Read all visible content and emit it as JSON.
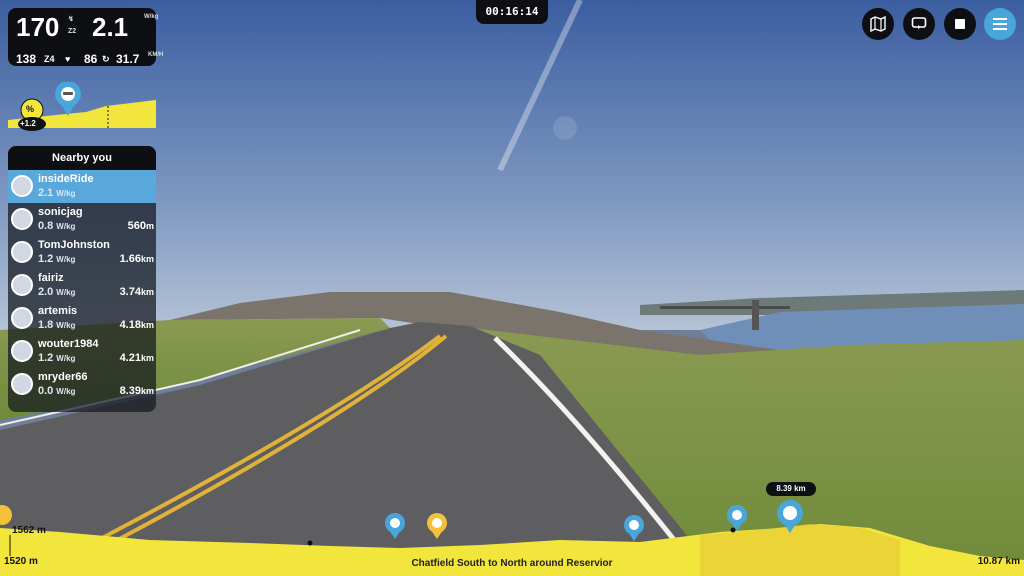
{
  "stats": {
    "power": "170",
    "power_zone": "Z2",
    "wkg": "2.1",
    "heart_rate": "138",
    "hr_zone": "Z4",
    "cadence": "86",
    "speed": "31.7",
    "speed_unit": "KM/H"
  },
  "timer": "00:16:14",
  "gradient": {
    "symbol": "%",
    "value": "+1.2"
  },
  "nearby": {
    "title": "Nearby you",
    "riders": [
      {
        "name": "insideRide",
        "power": "2.1",
        "unit": "W/kg",
        "distance": "",
        "dunit": "",
        "active": true
      },
      {
        "name": "sonicjag",
        "power": "0.8",
        "unit": "W/kg",
        "distance": "560",
        "dunit": "m"
      },
      {
        "name": "TomJohnston",
        "power": "1.2",
        "unit": "W/kg",
        "distance": "1.66",
        "dunit": "km"
      },
      {
        "name": "fairiz",
        "power": "2.0",
        "unit": "W/kg",
        "distance": "3.74",
        "dunit": "km"
      },
      {
        "name": "artemis",
        "power": "1.8",
        "unit": "W/kg",
        "distance": "4.18",
        "dunit": "km"
      },
      {
        "name": "wouter1984",
        "power": "1.2",
        "unit": "W/kg",
        "distance": "4.21",
        "dunit": "km"
      },
      {
        "name": "mryder66",
        "power": "0.0",
        "unit": "W/kg",
        "distance": "8.39",
        "dunit": "km"
      }
    ]
  },
  "profile": {
    "elev_max": "1562 m",
    "elev_min": "1520 m",
    "route_name": "Chatfield South to North around Reservior",
    "total_distance": "10.87 km",
    "marker_distance": "8.39 km"
  },
  "colors": {
    "accent": "#49a6db",
    "profile": "#f2e53c",
    "panel": "#0d0f12"
  },
  "icons": [
    "map-icon",
    "loop-icon",
    "stop-icon",
    "menu-icon"
  ]
}
